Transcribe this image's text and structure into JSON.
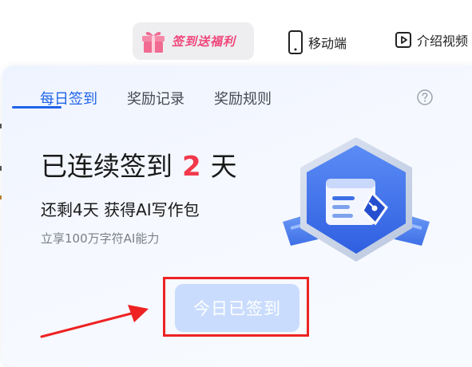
{
  "topbar": {
    "promo_label": "签到送福利",
    "mobile_label": "移动端",
    "video_label": "介绍视频"
  },
  "icons": {
    "gift": "gift-icon",
    "mobile": "mobile-phone-icon",
    "video": "play-video-icon",
    "help": "help-question-icon"
  },
  "card": {
    "tabs": [
      {
        "label": "每日签到",
        "active": true
      },
      {
        "label": "奖励记录",
        "active": false
      },
      {
        "label": "奖励规则",
        "active": false
      }
    ],
    "headline_prefix": "已连续签到",
    "days": "2",
    "headline_suffix": "天",
    "subline": "还剩4天 获得AI写作包",
    "smallline": "立享100万字符AI能力",
    "signed_button_label": "今日已签到"
  },
  "colors": {
    "accent_blue": "#1f63e9",
    "days_red": "#f2394b",
    "promo_pink": "#f0467a",
    "button_disabled": "#c9dcfd",
    "annotation_red": "#ee2222"
  }
}
